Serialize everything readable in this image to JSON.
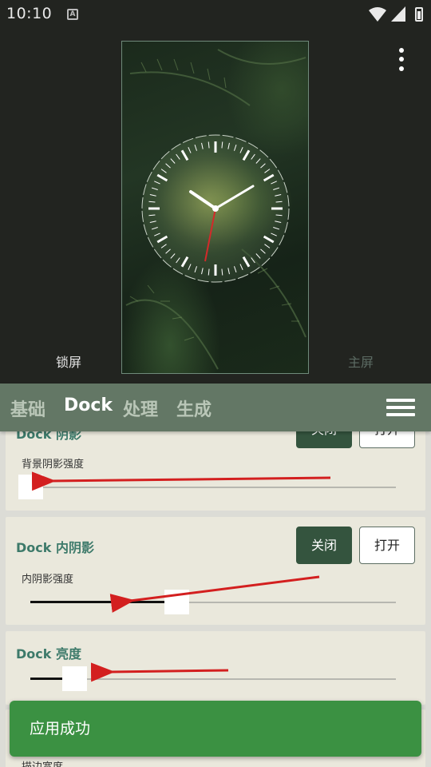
{
  "status": {
    "time": "10:10",
    "notification_icon": "A"
  },
  "preview": {
    "lock_label": "锁屏",
    "home_label": "主屏"
  },
  "tabs": [
    {
      "label": "基础",
      "active": false
    },
    {
      "label": "Dock",
      "active": true
    },
    {
      "label": "处理",
      "active": false
    },
    {
      "label": "生成",
      "active": false
    }
  ],
  "cards": {
    "dock_shadow": {
      "title": "Dock 阴影",
      "off_label": "关闭",
      "on_label": "打开",
      "slider_label": "背景阴影强度",
      "value": 0.0
    },
    "dock_inner_shadow": {
      "title": "Dock 内阴影",
      "off_label": "关闭",
      "on_label": "打开",
      "slider_label": "内阴影强度",
      "value": 0.4
    },
    "dock_brightness": {
      "title": "Dock 亮度",
      "value": 0.12
    },
    "dock_stroke": {
      "slider_label": "描边宽度"
    }
  },
  "toast": {
    "message": "应用成功"
  },
  "colors": {
    "accent": "#637765",
    "button_off": "#34543e",
    "title_text": "#3d7a6a",
    "toast": "#3b9142",
    "arrow": "#d31f1f"
  }
}
